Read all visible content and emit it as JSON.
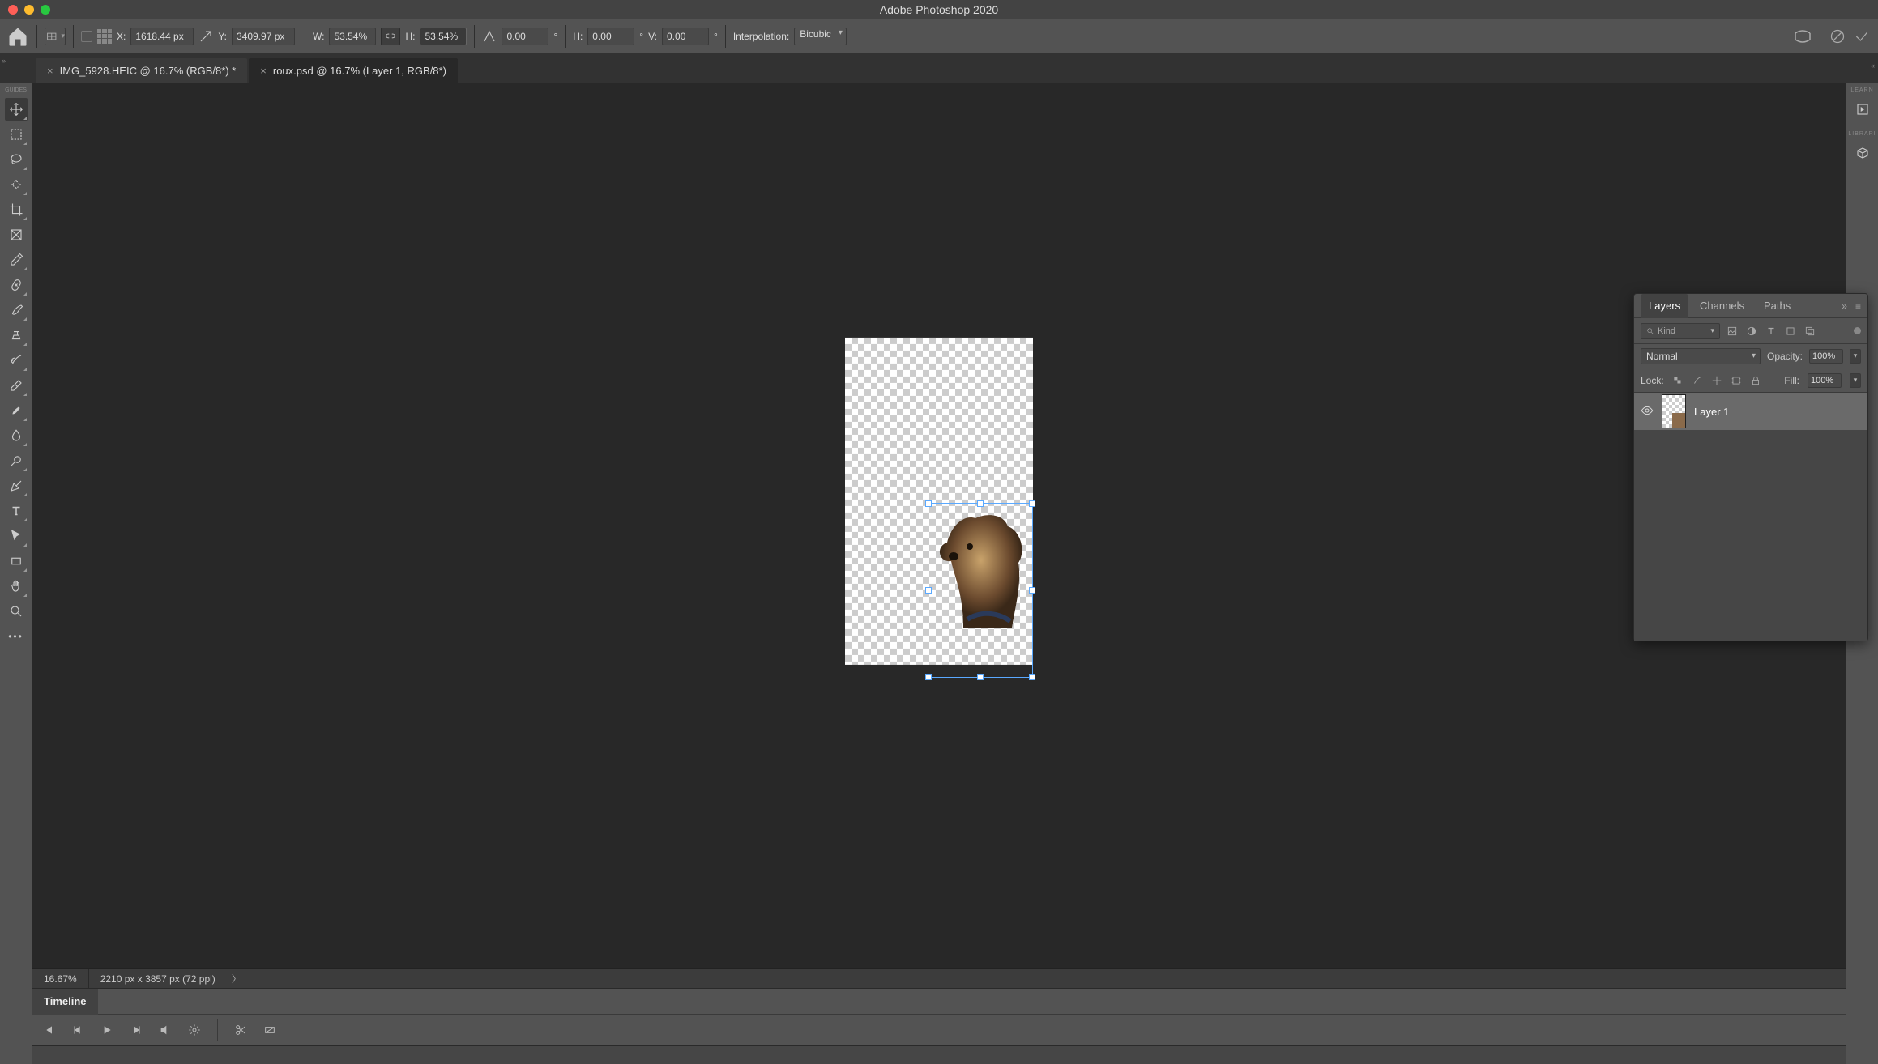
{
  "app_title": "Adobe Photoshop 2020",
  "tabs": [
    {
      "label": "IMG_5928.HEIC @ 16.7% (RGB/8*) *",
      "active": false
    },
    {
      "label": "roux.psd @ 16.7% (Layer 1, RGB/8*)",
      "active": true
    }
  ],
  "options_bar": {
    "x_label": "X:",
    "x_value": "1618.44 px",
    "y_label": "Y:",
    "y_value": "3409.97 px",
    "w_label": "W:",
    "w_value": "53.54%",
    "h_label": "H:",
    "h_value": "53.54%",
    "rot_value": "0.00",
    "skew_h_label": "H:",
    "skew_h_value": "0.00",
    "skew_v_label": "V:",
    "skew_v_value": "0.00",
    "interp_label": "Interpolation:",
    "interp_value": "Bicubic"
  },
  "status": {
    "zoom": "16.67%",
    "doc_info": "2210 px x 3857 px (72 ppi)"
  },
  "timeline": {
    "tab": "Timeline"
  },
  "layers_panel": {
    "tabs": [
      "Layers",
      "Channels",
      "Paths"
    ],
    "active_tab": "Layers",
    "filter_kind": "Kind",
    "blend_mode": "Normal",
    "opacity_label": "Opacity:",
    "opacity_value": "100%",
    "lock_label": "Lock:",
    "fill_label": "Fill:",
    "fill_value": "100%",
    "layers": [
      {
        "name": "Layer 1",
        "visible": true
      }
    ]
  },
  "right_col": {
    "label1": "LEARN",
    "label2": "LIBRARI"
  },
  "left_col_label": "GUIDES"
}
